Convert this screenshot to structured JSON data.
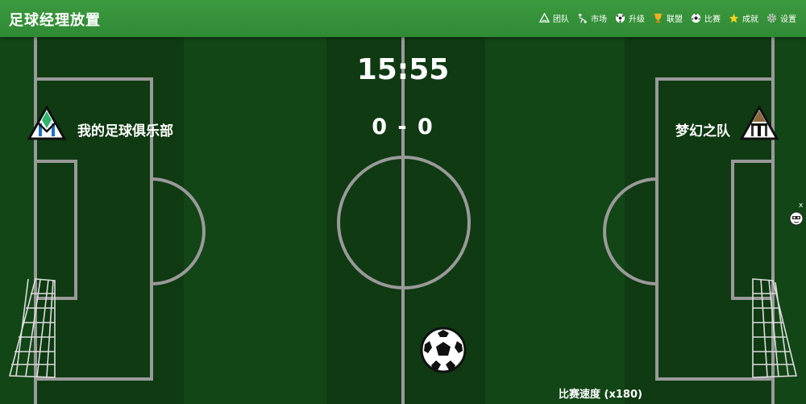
{
  "app": {
    "title": "足球经理放置"
  },
  "nav": [
    {
      "label": "团队",
      "icon": "team-icon"
    },
    {
      "label": "市场",
      "icon": "market-icon"
    },
    {
      "label": "升级",
      "icon": "upgrade-icon"
    },
    {
      "label": "联盟",
      "icon": "league-trophy-icon"
    },
    {
      "label": "比赛",
      "icon": "match-ball-icon"
    },
    {
      "label": "成就",
      "icon": "achievement-star-icon"
    },
    {
      "label": "设置",
      "icon": "gear-icon"
    }
  ],
  "match": {
    "clock": "15:55",
    "score": "0 - 0",
    "home_team": "我的足球俱乐部",
    "away_team": "梦幻之队",
    "speed_label": "比赛速度 (x180)"
  },
  "overlay": {
    "close_label": "x"
  },
  "colors": {
    "header": "#339039",
    "pitch_dark": "#0f3a12",
    "pitch_light": "#134617",
    "lines": "#9a9a9a"
  }
}
